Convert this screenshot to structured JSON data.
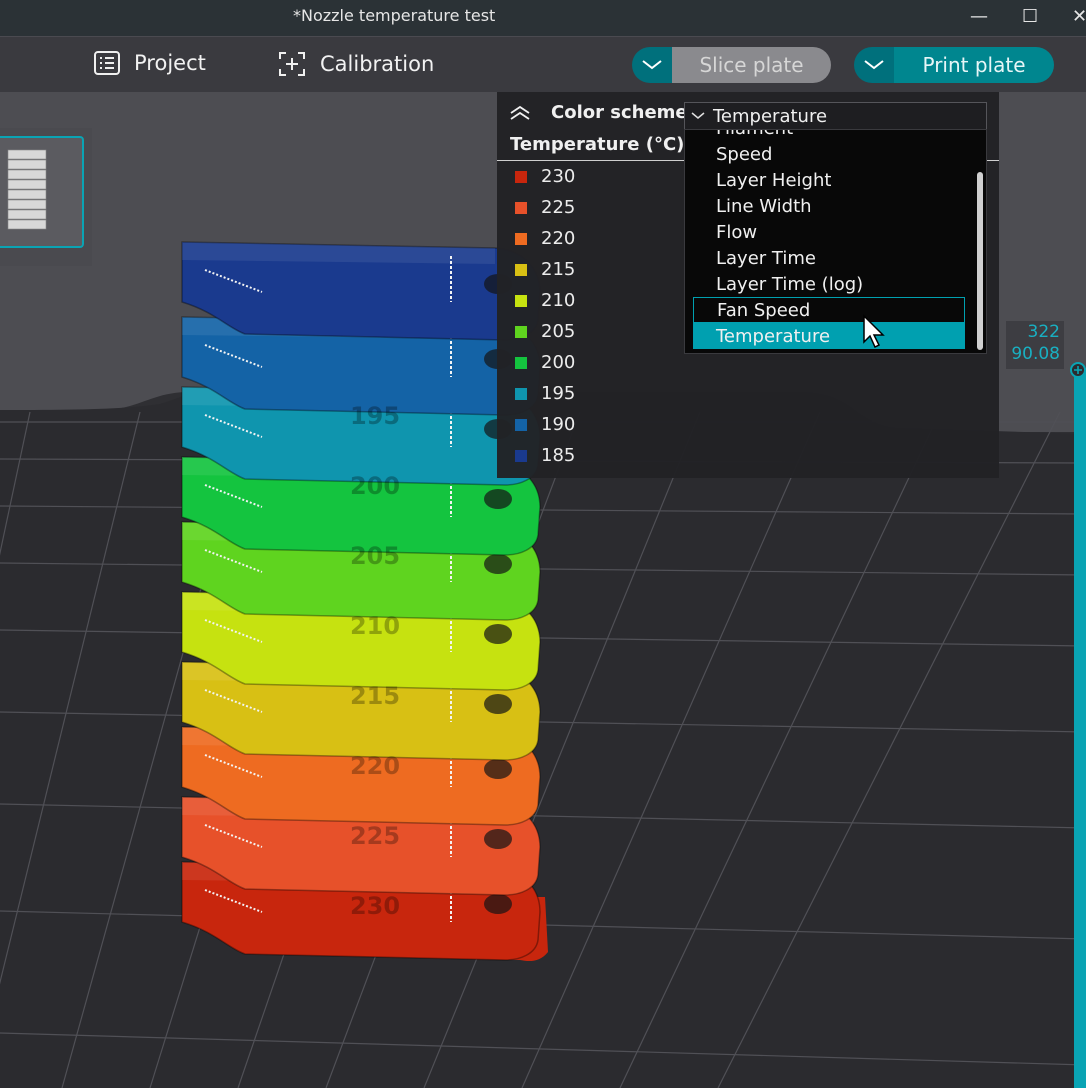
{
  "window": {
    "title": "*Nozzle temperature test",
    "minimize": "—",
    "maximize": "☐",
    "close": "✕"
  },
  "toolbar": {
    "project_label": "Project",
    "calibration_label": "Calibration",
    "slice_label": "Slice plate",
    "print_label": "Print plate"
  },
  "legend": {
    "color_scheme_label": "Color scheme",
    "selected_scheme": "Temperature",
    "title": "Temperature (°C)",
    "items": [
      {
        "label": "230",
        "color": "#c8260d"
      },
      {
        "label": "225",
        "color": "#e7512a"
      },
      {
        "label": "220",
        "color": "#ee6b21"
      },
      {
        "label": "215",
        "color": "#d8c014"
      },
      {
        "label": "210",
        "color": "#c6e210"
      },
      {
        "label": "205",
        "color": "#5fd41f"
      },
      {
        "label": "200",
        "color": "#14c43f"
      },
      {
        "label": "195",
        "color": "#0f95ae"
      },
      {
        "label": "190",
        "color": "#1463a6"
      },
      {
        "label": "185",
        "color": "#1a3a8e"
      }
    ]
  },
  "dropdown": {
    "items": [
      {
        "label": "Filament",
        "state": "partial"
      },
      {
        "label": "Speed",
        "state": "normal"
      },
      {
        "label": "Layer Height",
        "state": "normal"
      },
      {
        "label": "Line Width",
        "state": "normal"
      },
      {
        "label": "Flow",
        "state": "normal"
      },
      {
        "label": "Layer Time",
        "state": "normal"
      },
      {
        "label": "Layer Time (log)",
        "state": "normal"
      },
      {
        "label": "Fan Speed",
        "state": "hover"
      },
      {
        "label": "Temperature",
        "state": "selected"
      }
    ]
  },
  "coords": {
    "line1": "322",
    "line2": "90.08"
  },
  "accent": "#00a0b0",
  "tower_labels": [
    "230",
    "225",
    "220",
    "215",
    "210",
    "205",
    "200",
    "195"
  ]
}
